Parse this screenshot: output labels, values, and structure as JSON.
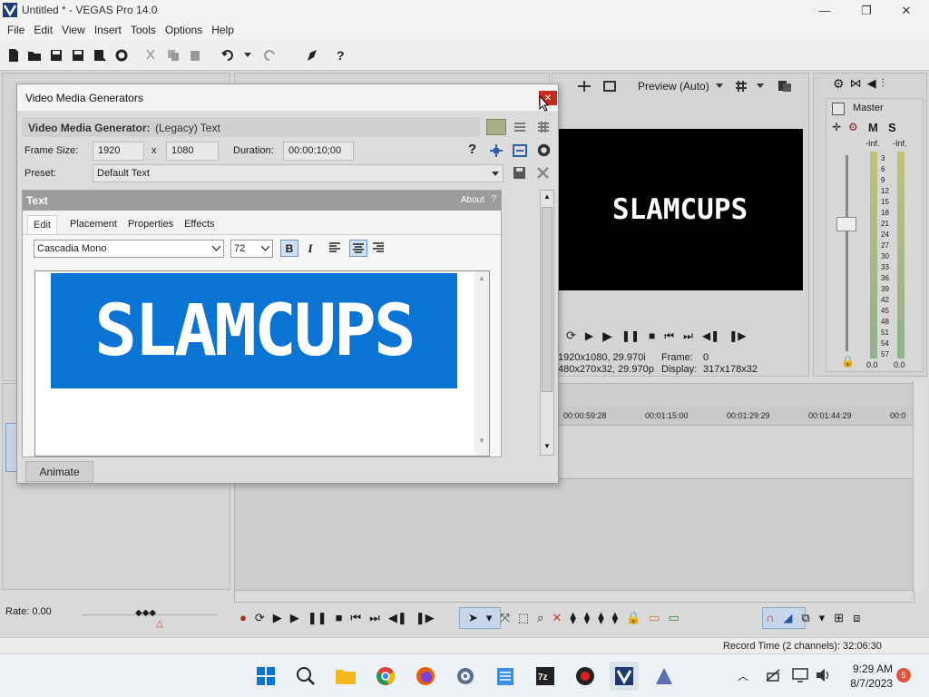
{
  "window": {
    "title": "Untitled * - VEGAS Pro 14.0",
    "minimize": "—",
    "restore": "❐",
    "close": "✕"
  },
  "menu": {
    "items": [
      "File",
      "Edit",
      "View",
      "Insert",
      "Tools",
      "Options",
      "Help"
    ]
  },
  "preview": {
    "mode_label": "Preview (Auto)",
    "video_text": "SLAMCUPS",
    "project_info": "1920x1080, 29.970i",
    "preview_info": "480x270x32, 29.970p",
    "frame_label": "Frame:",
    "frame_value": "0",
    "display_label": "Display:",
    "display_value": "317x178x32"
  },
  "mixer": {
    "master_label": "Master",
    "m_label": "M",
    "s_label": "S",
    "inf_left": "-Inf.",
    "inf_right": "-Inf.",
    "scale": [
      "3",
      "6",
      "9",
      "12",
      "15",
      "18",
      "21",
      "24",
      "27",
      "30",
      "33",
      "36",
      "39",
      "42",
      "45",
      "48",
      "51",
      "54",
      "57"
    ],
    "bottom_left": "0.0",
    "bottom_right": "0.0"
  },
  "timeline": {
    "ruler": [
      "00:00:59:28",
      "00:01:15:00",
      "00:01:29:29",
      "00:01:44:29",
      "00:0"
    ]
  },
  "dialog": {
    "title": "Video Media Generators",
    "close": "✕",
    "generator_label": "Video Media Generator:",
    "generator_value": "(Legacy) Text",
    "frame_size_label": "Frame Size:",
    "width": "1920",
    "x": "x",
    "height": "1080",
    "duration_label": "Duration:",
    "duration": "00:00:10;00",
    "help": "?",
    "preset_label": "Preset:",
    "preset_value": "Default Text",
    "text_panel_title": "Text",
    "about": "About",
    "about_q": "?",
    "tabs": [
      "Edit",
      "Placement",
      "Properties",
      "Effects"
    ],
    "font": "Cascadia Mono",
    "size": "72",
    "bold": "B",
    "italic": "I",
    "text_content": "SLAMCUPS",
    "animate": "Animate"
  },
  "rate": {
    "label": "Rate: 0.00"
  },
  "status": {
    "record_time": "Record Time (2 channels): 32:06:30"
  },
  "taskbar": {
    "time": "9:29 AM",
    "date": "8/7/2023",
    "notification_count": "5"
  }
}
